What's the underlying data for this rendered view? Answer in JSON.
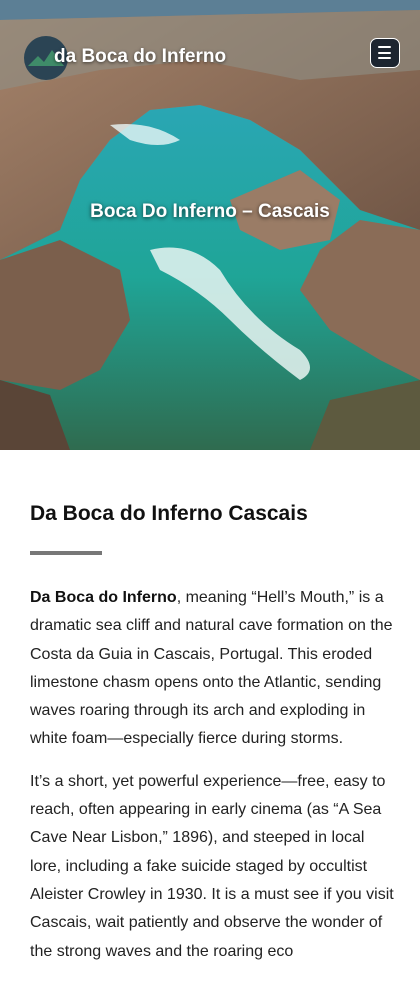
{
  "header": {
    "site_title": "da Boca do Inferno",
    "menu_icon": "hamburger-menu-icon"
  },
  "hero": {
    "heading": "Boca Do Inferno – Cascais"
  },
  "article": {
    "title": "Da Boca do Inferno Cascais",
    "paragraphs": [
      {
        "bold": "Da Boca do Inferno",
        "text": ", meaning “Hell’s Mouth,” is a dramatic sea cliff and natural cave formation on the Costa da Guia in Cascais, Portugal. This eroded limestone chasm opens onto the Atlantic, sending waves roaring through its arch and exploding in white foam—especially fierce during storms."
      },
      {
        "text": "It’s a short, yet powerful experience—free, easy to reach, often appearing in early cinema (as “A Sea Cave Near Lisbon,” 1896), and steeped in local lore, including a fake suicide staged by occultist Aleister Crowley in 1930. It is a must see if you visit Cascais, wait patiently and observe the wonder of the strong waves and the roaring eco"
      }
    ]
  },
  "colors": {
    "divider": "#777777",
    "menu_button_bg": "#1d2530"
  }
}
